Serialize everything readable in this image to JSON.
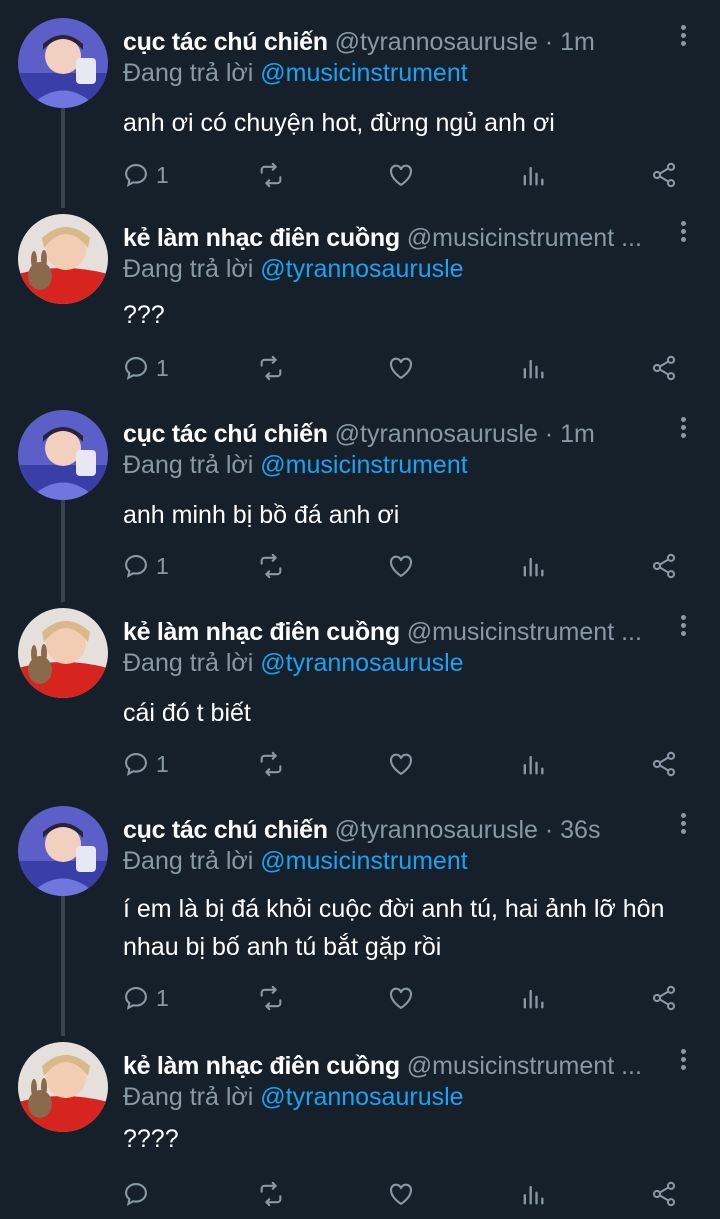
{
  "icons": {
    "reply": "reply-bubble-icon",
    "retweet": "retweet-icon",
    "like": "heart-icon",
    "analytics": "analytics-bars-icon",
    "share": "share-icon",
    "more": "more-vertical-icon"
  },
  "colors": {
    "background": "#15202b",
    "muted": "#8899a6",
    "link": "#1da1f2",
    "thread_line": "#38444d"
  },
  "tweets": [
    {
      "name": "cục tác chú chiến",
      "handle_time": "@tyrannosaurusle · 1m",
      "reply_prefix": "Đang trả lời",
      "reply_to": "@musicinstrument",
      "text": "anh ơi có chuyện hot, đừng ngủ anh ơi",
      "reply_count": "1"
    },
    {
      "name": "kẻ làm nhạc điên cuồng",
      "handle_time": "@musicinstrument ...",
      "reply_prefix": "Đang trả lời",
      "reply_to": "@tyrannosaurusle",
      "text": "???",
      "reply_count": "1"
    },
    {
      "name": "cục tác chú chiến",
      "handle_time": "@tyrannosaurusle · 1m",
      "reply_prefix": "Đang trả lời",
      "reply_to": "@musicinstrument",
      "text": "anh minh bị bồ đá anh ơi",
      "reply_count": "1"
    },
    {
      "name": "kẻ làm nhạc điên cuồng",
      "handle_time": "@musicinstrument ...",
      "reply_prefix": "Đang trả lời",
      "reply_to": "@tyrannosaurusle",
      "text": "cái đó t biết",
      "reply_count": "1"
    },
    {
      "name": "cục tác chú chiến",
      "handle_time": "@tyrannosaurusle · 36s",
      "reply_prefix": "Đang trả lời",
      "reply_to": "@musicinstrument",
      "text": "í em là bị đá khỏi cuộc đời anh tú, hai ảnh lỡ hôn nhau bị bố anh tú bắt gặp rồi",
      "reply_count": "1"
    },
    {
      "name": "kẻ làm nhạc điên cuồng",
      "handle_time": "@musicinstrument ...",
      "reply_prefix": "Đang trả lời",
      "reply_to": "@tyrannosaurusle",
      "text": "????",
      "reply_count": ""
    }
  ]
}
